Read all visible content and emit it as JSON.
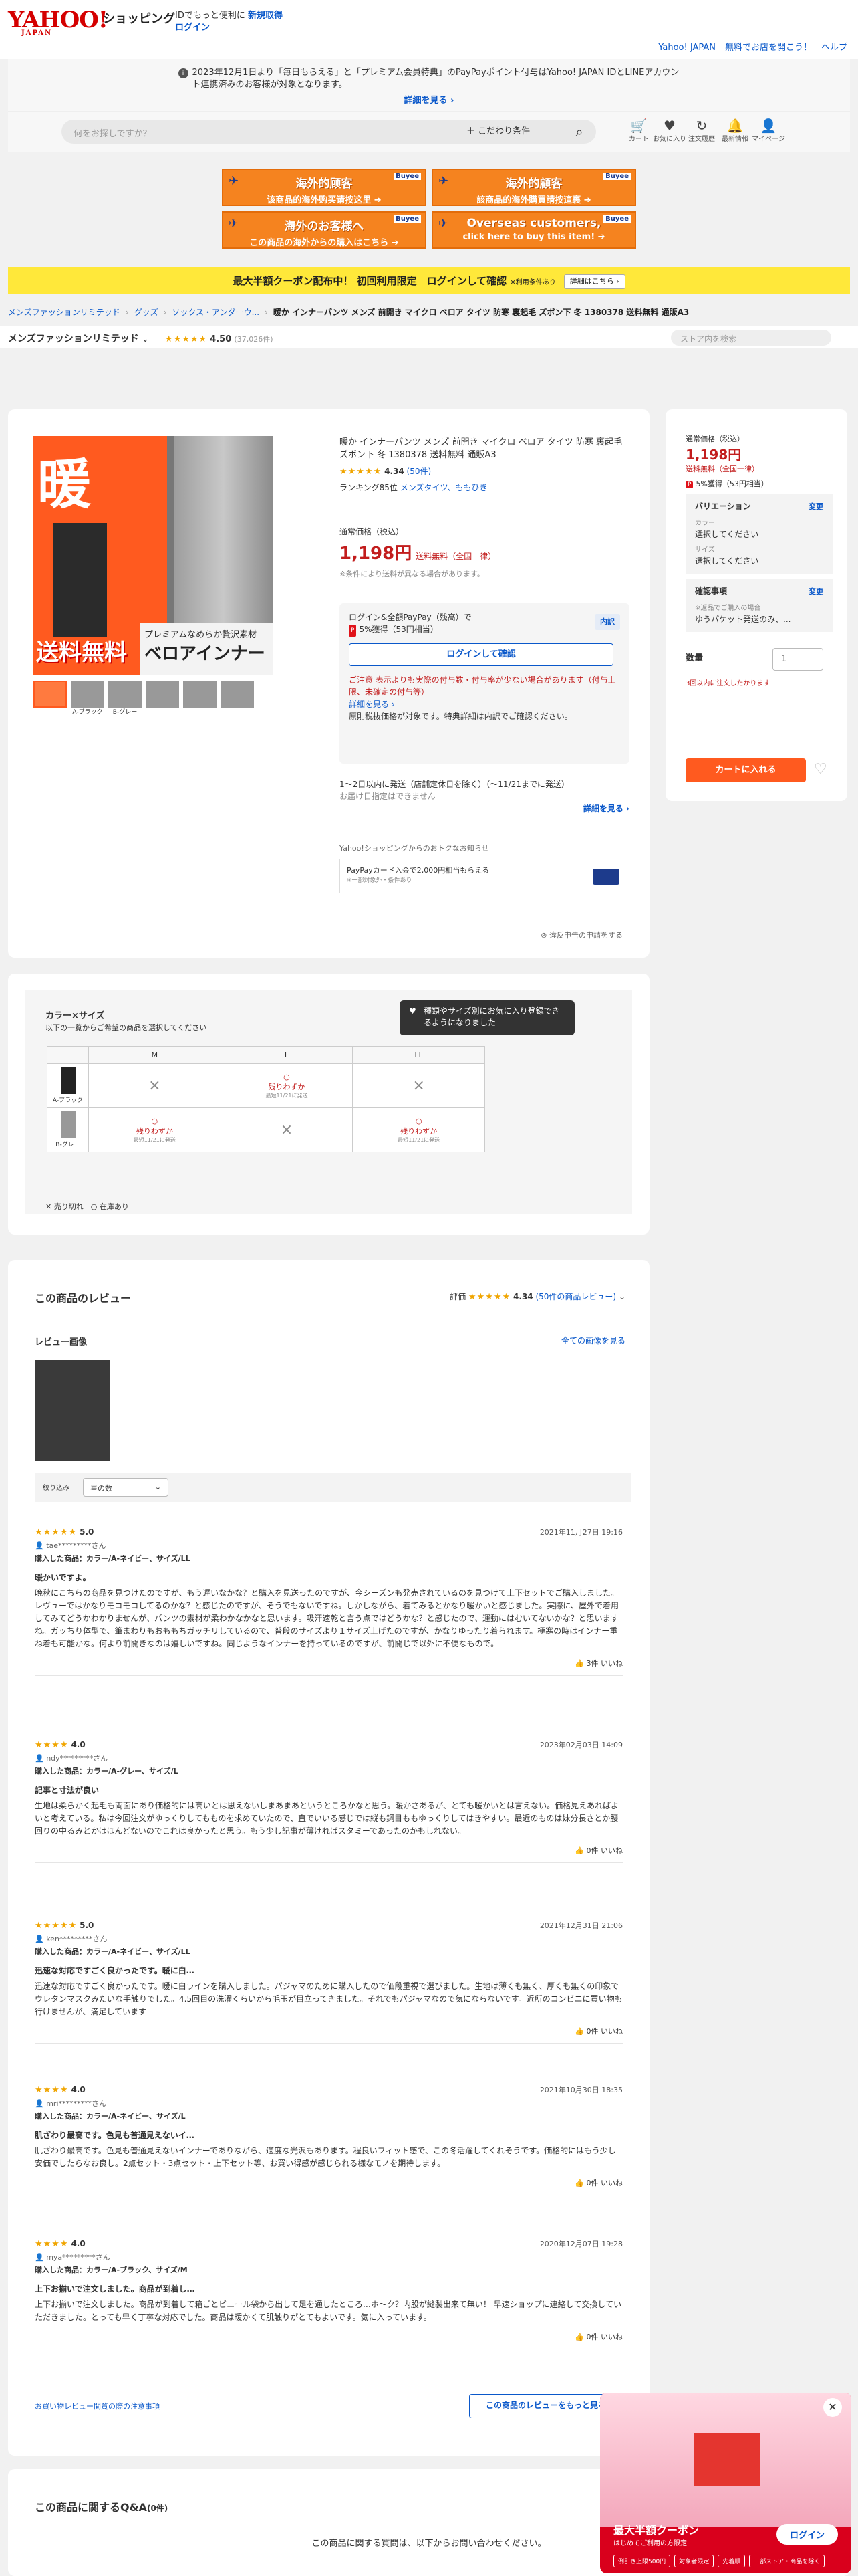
{
  "header": {
    "logo": "YAHOO!",
    "logo_sub": "JAPAN",
    "site": "ショッピング",
    "id_msg": "IDでもっと便利に",
    "register": "新規取得",
    "login": "ログイン",
    "yj_link": "Yahoo! JAPAN",
    "free_link": "無料でお店を開こう！",
    "help": "ヘルプ"
  },
  "notice": {
    "text": "2023年12月1日より「毎日もらえる」と「プレミアム会員特典」のPayPayポイント付与はYahoo! JAPAN IDとLINEアカウント連携済みのお客様が対象となります。",
    "more": "詳細を見る ›"
  },
  "search": {
    "placeholder": "何をお探しですか？",
    "cond": "＋ こだわり条件"
  },
  "nav": [
    {
      "icon": "cart-icon",
      "label": "カート"
    },
    {
      "icon": "heart-icon",
      "label": "お気に入り"
    },
    {
      "icon": "history-icon",
      "label": "注文履歴"
    },
    {
      "icon": "bell-icon",
      "label": "最新情報"
    },
    {
      "icon": "user-icon",
      "label": "マイページ"
    }
  ],
  "banners": [
    {
      "t1": "海外的顾客",
      "t2": "该商品的海外购买请按这里 ➔"
    },
    {
      "t1": "海外的顧客",
      "t2": "該商品的海外購買請按這裏 ➔"
    },
    {
      "t1": "海外のお客様へ",
      "t2": "この商品の海外からの購入はこちら ➔"
    },
    {
      "t1": "Overseas customers,",
      "t2": "click here to buy this item! ➔"
    }
  ],
  "banner_logo": "Buyee",
  "coupon": {
    "text": "最大半額クーポン配布中！ 初回利用限定　ログインして確認",
    "note": "※利用条件あり",
    "btn": "詳細はこちら ›"
  },
  "breadcrumb": [
    "メンズファッションリミテッド",
    "グッズ",
    "ソックス・アンダーウ..."
  ],
  "breadcrumb_current": "暖か インナーパンツ メンズ 前開き マイクロ ベロア タイツ 防寒 裏起毛 ズボン下 冬 1380378 送料無料 通販A3",
  "store": {
    "name": "メンズファッションリミテッド",
    "rating": "4.50",
    "count": "(37,026件)",
    "search_placeholder": "ストア内を検索"
  },
  "product": {
    "title": "暖か インナーパンツ メンズ 前開き マイクロ ベロア タイツ 防寒 裏起毛 ズボン下 冬 1380378 送料無料 通販A3",
    "rating": "4.34",
    "reviews": "(50件)",
    "ranking": "ランキング85位",
    "ranking_cat": "メンズタイツ、ももひき",
    "price_label": "通常価格（税込）",
    "price": "1,198円",
    "shipping": "送料無料（全国一律）",
    "price_note": "※条件により送料が異なる場合があります。",
    "paypay_login": "ログイン&全額PayPay（残高）で",
    "paypay_rate": "5%獲得（53円相当）",
    "naiyaku": "内訳",
    "login_btn": "ログインして確認",
    "caution": "ご注意 表示よりも実際の付与数・付与率が少ない場合があります（付与上限、未確定の付与等）",
    "caution_more": "詳細を見る ›",
    "caution2": "原則税抜価格が対象です。特典詳細は内訳でご確認ください。",
    "ship1": "1〜2日以内に発送（店舗定休日を除く）（〜11/21までに発送）",
    "ship2": "お届け日指定はできません",
    "ship_more": "詳細を見る ›",
    "promo_title": "Yahoo!ショッピングからのおトクなお知らせ",
    "promo_text": "PayPayカード入会で2,000円相当もらえる",
    "promo_sub": "※一部対象外・条件あり",
    "report": "違反申告の申請をする"
  },
  "gallery": {
    "kanji": "暖",
    "free": "送料無料",
    "band_a": "プレミアムなめらか贅沢素材",
    "band_b": "ベロアインナー",
    "thumbs": [
      "",
      "A-ブラック",
      "B-グレー",
      "",
      "",
      "",
      ""
    ]
  },
  "side": {
    "price_label": "通常価格（税込）",
    "price": "1,198円",
    "shipping": "送料無料（全国一律）",
    "points": "5%獲得（53円相当）",
    "variation": "バリエーション",
    "change": "変更",
    "color": "カラー",
    "color_val": "選択してください",
    "size": "サイズ",
    "size_val": "選択してください",
    "confirm": "確認事項",
    "confirm_note": "※返品でご購入の場合",
    "confirm_val": "ゆうパケット発送のみ、...",
    "qty": "数量",
    "qty_val": "1",
    "qty_note": "3回以内に注文したかります",
    "cart": "カートに入れる"
  },
  "colorsize": {
    "title": "カラー×サイズ",
    "sub": "以下の一覧からご希望の商品を選択してください",
    "tip": "種類やサイズ別にお気に入り登録できるようになりました",
    "sizes": [
      "M",
      "L",
      "LL"
    ],
    "rows": [
      {
        "label": "A-ブラック",
        "cells": [
          "×",
          "残りわずか",
          "×"
        ]
      },
      {
        "label": "B-グレー",
        "cells": [
          "残りわずか",
          "×",
          "残りわずか"
        ]
      }
    ],
    "ship_note": "最短11/21に発送",
    "legend_x": "売り切れ",
    "legend_o": "在庫あり"
  },
  "reviews": {
    "title": "この商品のレビュー",
    "score_label": "評価",
    "score": "4.34",
    "count": "(50件の商品レビュー)",
    "images_title": "レビュー画像",
    "all_images": "全ての画像を見る",
    "filter_label": "絞り込み",
    "filter_val": "星の数",
    "items": [
      {
        "stars": "★★★★★",
        "score": "5.0",
        "date": "2021年11月27日 19:16",
        "user": "tae*********さん",
        "buy": "購入した商品：カラー/A-ネイビー、サイズ/LL",
        "title": "暖かいですよ。",
        "body": "晩秋にこちらの商品を見つけたのですが、もう遅いなかな？と購入を見送ったのですが、今シーズンも発売されているのを見つけて上下セットでご購入しました。レヴューではかなりモコモコしてるのかな？と感じたのですが、そうでもないですね。しかしながら、着てみるとかなり暖かいと感じました。実際に、屋外で着用してみてどうかわかりませんが、パンツの素材が柔わかなかなと思います。吸汗速乾と言う点ではどうかな？と感じたので、運動にはむいてないかな？と思いますね。ガッちり体型で、筆まわりもおももちガッチリしているので、普段のサイズより１サイズ上げたのですが、かなりゆったり着られます。極寒の時はインナー重ね着も可能かな。何より前開きなのは嬉しいですね。同じようなインナーを持っているのですが、前開じで以外に不便なもので。",
        "like": "3件 いいね"
      },
      {
        "stars": "★★★★",
        "score": "4.0",
        "date": "2023年02月03日 14:09",
        "user": "ndy*********さん",
        "buy": "購入した商品：カラー/A-グレー、サイズ/L",
        "title": "記事と寸法が良い",
        "body": "生地は柔らかく起毛も両面にあり価格的には高いとは思えないしまあまあというところかなと思う。暖かさあるが、とても暖かいとは言えない。価格見えあればよいと考えている。私は今回注文がゆっくりしてもものを求めていたので、直でいいる感じでは縦も鋼目ももゆっくりしてはきやすい。最近のものは妹分長さとか腰回りの中るみとかはほんどないのでこれは良かったと思う。もう少し記事が薄ければスタミーであったのかもしれない。",
        "like": "0件 いいね"
      },
      {
        "stars": "★★★★★",
        "score": "5.0",
        "date": "2021年12月31日 21:06",
        "user": "ken*********さん",
        "buy": "購入した商品：カラー/A-ネイビー、サイズ/LL",
        "title": "迅速な対応ですごく良かったです。暖に白…",
        "body": "迅速な対応ですごく良かったです。暖に白ラインを購入しました。パジャマのために購入したので価段重視で選びました。生地は薄くも無く、厚くも無くの印象でウレタンマスクみたいな手触りでした。4.5回目の洗濯くらいから毛玉が目立ってきました。それでもパジャマなので気にならないです。近所のコンビニに買い物も行けませんが、満足しています",
        "like": "0件 いいね"
      },
      {
        "stars": "★★★★",
        "score": "4.0",
        "date": "2021年10月30日 18:35",
        "user": "mri*********さん",
        "buy": "購入した商品：カラー/A-ネイビー、サイズ/L",
        "title": "肌ざわり最高です。色見も普通見えないイ…",
        "body": "肌ざわり最高です。色見も普通見えないインナーでありながら、適度な光沢もあります。程良いフィット感で、この冬活躍してくれそうです。価格的にはもう少し安価でしたらなお良し。2点セット・3点セット・上下セット等、お買い得感が感じられる様なモノを期待します。",
        "like": "0件 いいね"
      },
      {
        "stars": "★★★★",
        "score": "4.0",
        "date": "2020年12月07日 19:28",
        "user": "mya*********さん",
        "buy": "購入した商品：カラー/A-ブラック、サイズ/M",
        "title": "上下お揃いで注文しました。商品が到着し…",
        "body": "上下お揃いで注文しました。商品が到着して箱ごとビニール袋から出して足を通したところ…ホ〜ク？内股が縫製出来て無い！ 早速ショップに連絡して交換していただきました。とっても早く丁寧な対応でした。商品は暖かくて肌触りがとてもよいです。気に入っています。",
        "like": "0件 いいね"
      }
    ],
    "footer_link": "お買い物レビュー閲覧の際の注意事項",
    "write_btn": "この商品のレビューをもっと見る"
  },
  "qa": {
    "title": "この商品に関するQ&A",
    "count": "(0件)",
    "note": "この商品に関する質問は、以下からお問い合わせください。"
  },
  "popup": {
    "title": "最大半額クーポン",
    "sub": "はじめてご利用の方限定",
    "login": "ログイン",
    "chips": [
      "例引き上限500円",
      "対象者限定",
      "先着順",
      "一部ストア・商品を除く"
    ]
  }
}
